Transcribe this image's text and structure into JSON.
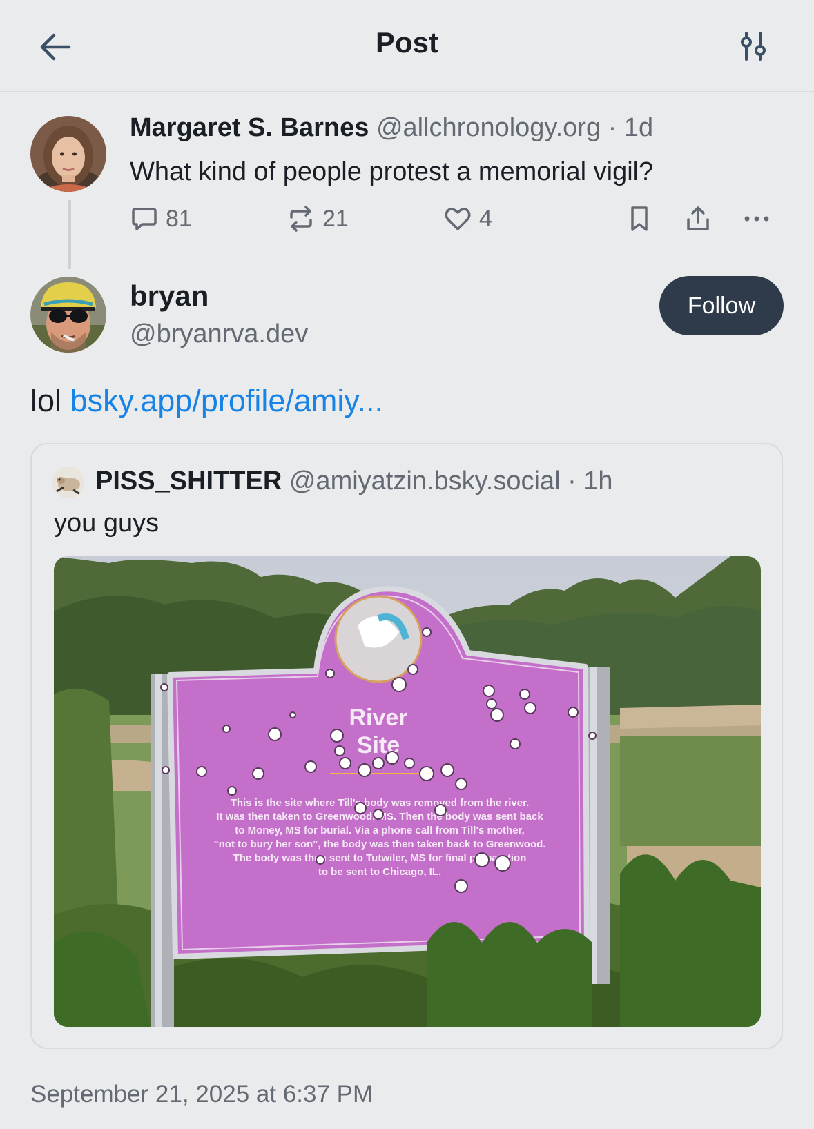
{
  "header": {
    "title": "Post",
    "back_icon": "arrow-left-icon",
    "filter_icon": "sliders-icon"
  },
  "parent_post": {
    "author_name": "Margaret S. Barnes",
    "handle": "@allchronology.org",
    "separator": "·",
    "age": "1d",
    "text": "What kind of people protest a memorial vigil?",
    "replies": "81",
    "reposts": "21",
    "likes": "4"
  },
  "main_post": {
    "author_name": "bryan",
    "handle": "@bryanrva.dev",
    "follow_label": "Follow",
    "text_prefix": "lol",
    "link_text": "bsky.app/profile/amiy..."
  },
  "quoted_post": {
    "author_name": "PISS_SHITTER",
    "handle": "@amiyatzin.bsky.social",
    "separator": "·",
    "age": "1h",
    "text": "you guys",
    "image": {
      "sign_title_line1": "River",
      "sign_title_line2": "Site",
      "sign_body": [
        "This is the site where Till's body was removed from the river.",
        "It was then taken to Greenwood, MS. Then the body was sent back",
        "to Money, MS for burial. Via a phone call from Till's mother,",
        "\"not to bury her son\", the body was then taken back to Greenwood.",
        "The body was then sent to Tutwiler, MS for final preparation",
        "to be sent to Chicago, IL."
      ]
    }
  },
  "timestamp": "September 21, 2025 at 6:37 PM",
  "colors": {
    "background": "#eaebec",
    "link": "#1883e6",
    "follow_button": "#2f3b4a",
    "sign": "#c46fc9",
    "muted_text": "#646a73"
  }
}
